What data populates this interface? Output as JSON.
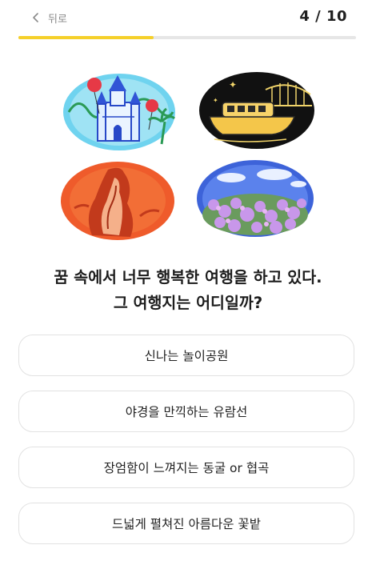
{
  "header": {
    "back_label": "뒤로",
    "counter": "4 / 10",
    "progress": {
      "current": 4,
      "total": 10,
      "fraction": 0.4
    }
  },
  "illustrations": [
    {
      "name": "amusement-park",
      "palette": "cyan-blue-red"
    },
    {
      "name": "night-cruise",
      "palette": "black-yellow"
    },
    {
      "name": "cave-canyon",
      "palette": "orange-red"
    },
    {
      "name": "flower-field",
      "palette": "blue-purple"
    }
  ],
  "question": {
    "line1": "꿈 속에서 너무 행복한 여행을 하고 있다.",
    "line2": "그 여행지는 어디일까?"
  },
  "options": [
    {
      "label": "신나는 놀이공원"
    },
    {
      "label": "야경을 만끽하는 유람선"
    },
    {
      "label": "장엄함이 느껴지는 동굴 or 협곡"
    },
    {
      "label": "드넓게 펼쳐진 아름다운 꽃밭"
    }
  ],
  "colors": {
    "accent": "#f5d02a",
    "track": "#e6e6e6",
    "border": "#e2e2e2",
    "text": "#222222"
  }
}
